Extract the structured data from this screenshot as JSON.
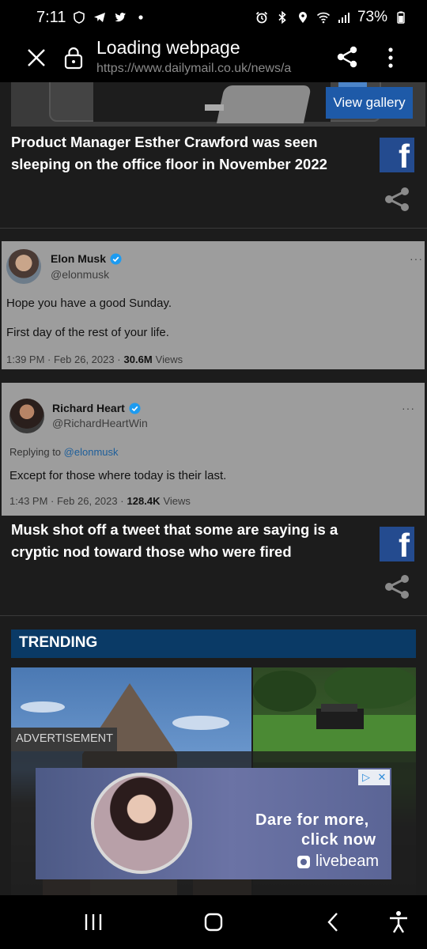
{
  "status_bar": {
    "time": "7:11",
    "battery": "73%"
  },
  "browser": {
    "title": "Loading webpage",
    "url": "https://www.dailymail.co.uk/news/a"
  },
  "article": {
    "view_gallery": "View gallery",
    "caption1": "Product Manager Esther Crawford was seen sleeping on the office floor in November 2022",
    "caption2": "Musk shot off a tweet that some are saying is a cryptic nod toward those who were fired",
    "facebook_glyph": "f"
  },
  "tweets": [
    {
      "name": "Elon Musk",
      "handle": "@elonmusk",
      "more": "···",
      "lines": [
        "Hope you have a good Sunday.",
        "First day of the rest of your life."
      ],
      "time_date": "1:39 PM · Feb 26, 2023 ·",
      "views_count": "30.6M",
      "views_label": "Views"
    },
    {
      "name": "Richard Heart",
      "handle": "@RichardHeartWin",
      "more": "···",
      "reply_prefix": "Replying to",
      "reply_mention": "@elonmusk",
      "lines": [
        "Except for those where today is their last."
      ],
      "time_date": "1:43 PM · Feb 26, 2023 ·",
      "views_count": "128.4K",
      "views_label": "Views"
    }
  ],
  "trending": {
    "label": "TRENDING"
  },
  "advertisement": {
    "label": "ADVERTISEMENT",
    "line1": "Dare for more,",
    "line2": "click now",
    "brand": "livebeam",
    "adchoices": "▷",
    "close": "✕"
  },
  "colors": {
    "trending_bg": "#0a3a66",
    "facebook_blue": "#244b8f",
    "gallery_blue": "#1e5aa8",
    "verified_blue": "#1d9bf0"
  }
}
